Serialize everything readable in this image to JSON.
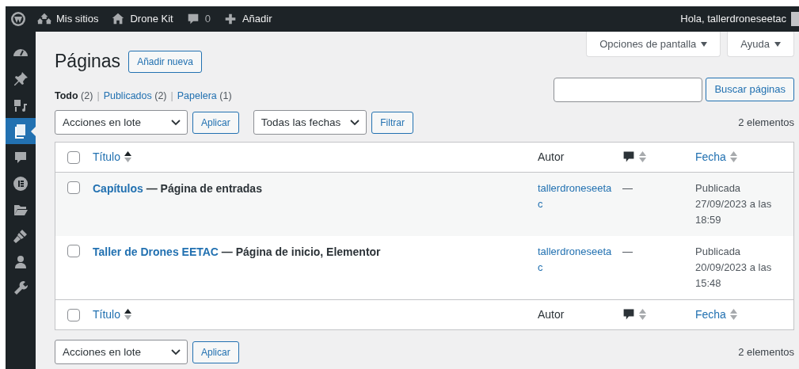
{
  "admin_bar": {
    "items": [
      {
        "kind": "logo"
      },
      {
        "kind": "sites",
        "label": "Mis sitios"
      },
      {
        "kind": "home",
        "label": "Drone Kit"
      },
      {
        "kind": "comments",
        "label": "0"
      },
      {
        "kind": "new",
        "label": "Añadir"
      }
    ],
    "greeting": "Hola, tallerdroneseetac"
  },
  "sidebar": {
    "items": [
      {
        "kind": "dashboard",
        "selected": false
      },
      {
        "kind": "pin",
        "selected": false
      },
      {
        "kind": "media",
        "selected": false
      },
      {
        "kind": "pages",
        "selected": true
      },
      {
        "kind": "comments",
        "selected": false
      },
      {
        "kind": "elementor",
        "selected": false
      },
      {
        "kind": "folder",
        "selected": false
      },
      {
        "kind": "brush",
        "selected": false
      },
      {
        "kind": "users",
        "selected": false
      },
      {
        "kind": "tools",
        "selected": false
      }
    ]
  },
  "screen_tabs": [
    "Opciones de pantalla",
    "Ayuda"
  ],
  "heading": "Páginas",
  "add_new": "Añadir nueva",
  "views": [
    {
      "label": "Todo",
      "count": "(2)",
      "selected": true
    },
    {
      "separator": "|",
      "label": "Publicados",
      "count": "(2)",
      "selected": false
    },
    {
      "separator": "|",
      "label": "Papelera",
      "count": "(1)",
      "selected": false
    }
  ],
  "search": {
    "button": "Buscar páginas"
  },
  "top_nav": {
    "bulk_select": "Acciones en lote",
    "apply": "Aplicar",
    "date_select": "Todas las fechas",
    "filter": "Filtrar",
    "count": "2 elementos"
  },
  "table": {
    "header_select_all": false,
    "header": [
      {
        "kind": "title",
        "label": "Título",
        "sorted": true
      },
      {
        "kind": "author",
        "label": "Autor"
      },
      {
        "kind": "comments",
        "sorted": false
      },
      {
        "kind": "date",
        "label": "Fecha",
        "sorted": false
      }
    ],
    "rows": [
      {
        "checked": false,
        "title": "Capítulos",
        "states": "— Página de entradas",
        "author": "tallerdroneseetac",
        "comments": "—",
        "status": "Publicada",
        "date": "27/09/2023 a las 18:59"
      },
      {
        "checked": false,
        "title": "Taller de Drones EETAC",
        "states": "— Página de inicio, Elementor",
        "author": "tallerdroneseetac",
        "comments": "—",
        "status": "Publicada",
        "date": "20/09/2023 a las 15:48"
      }
    ],
    "footer_select_all": false,
    "footer": [
      {
        "kind": "title",
        "label": "Título",
        "sorted": true
      },
      {
        "kind": "author",
        "label": "Autor"
      },
      {
        "kind": "comments",
        "sorted": false
      },
      {
        "kind": "date",
        "label": "Fecha",
        "sorted": false
      }
    ]
  },
  "bottom_nav": {
    "bulk_select": "Acciones en lote",
    "apply": "Aplicar",
    "count": "2 elementos"
  }
}
